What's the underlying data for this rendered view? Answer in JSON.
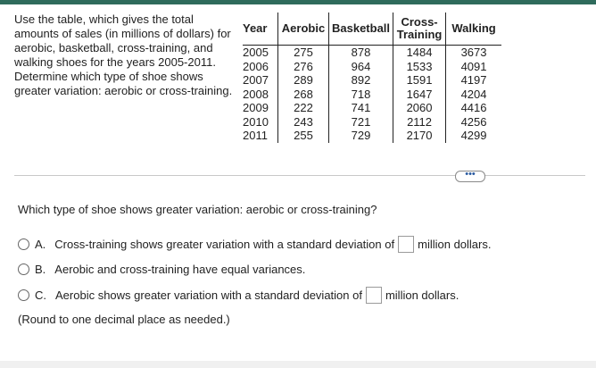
{
  "intro": {
    "lines": [
      "Use the table, which gives the total",
      "amounts of sales (in millions of dollars) for",
      "aerobic, basketball, cross-training, and",
      "walking shoes for the years 2005-2011.",
      "Determine which type of shoe shows",
      "greater variation: aerobic or cross-training."
    ]
  },
  "table": {
    "headers": {
      "year": "Year",
      "aerobic": "Aerobic",
      "basketball": "Basketball",
      "cross_line1": "Cross-",
      "cross_line2": "Training",
      "walking": "Walking"
    },
    "rows": [
      [
        "2005",
        "275",
        "878",
        "1484",
        "3673"
      ],
      [
        "2006",
        "276",
        "964",
        "1533",
        "4091"
      ],
      [
        "2007",
        "289",
        "892",
        "1591",
        "4197"
      ],
      [
        "2008",
        "268",
        "718",
        "1647",
        "4204"
      ],
      [
        "2009",
        "222",
        "741",
        "2060",
        "4416"
      ],
      [
        "2010",
        "243",
        "721",
        "2112",
        "4256"
      ],
      [
        "2011",
        "255",
        "729",
        "2170",
        "4299"
      ]
    ]
  },
  "more_button": {
    "label": "•••"
  },
  "question": "Which type of shoe shows greater variation: aerobic or cross-training?",
  "options": {
    "a": {
      "letter": "A.",
      "before": "Cross-training shows greater variation with a standard deviation of",
      "after": "million dollars.",
      "value": ""
    },
    "b": {
      "letter": "B.",
      "text": "Aerobic and cross-training have equal variances."
    },
    "c": {
      "letter": "C.",
      "before": "Aerobic shows greater variation with a standard deviation of",
      "after": "million dollars.",
      "value": ""
    }
  },
  "note": "(Round to one decimal place as needed.)",
  "colors": {
    "top_bar": "#2f6b5c",
    "more_button_dots": "#2a5aa0"
  }
}
